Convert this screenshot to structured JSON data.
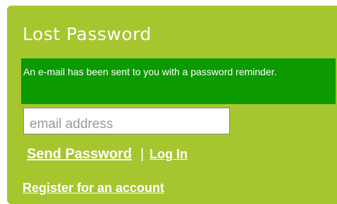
{
  "lost_password": {
    "title": "Lost Password",
    "notice_message": "An e-mail has been sent to you with a password reminder.",
    "email_placeholder": "email address",
    "send_password_label": "Send Password",
    "separator": "|",
    "login_label": "Log In",
    "register_label": "Register for an account"
  },
  "colors": {
    "panel_background": "#a5c62f",
    "notice_background": "#0b9a00",
    "text": "#ffffff"
  }
}
